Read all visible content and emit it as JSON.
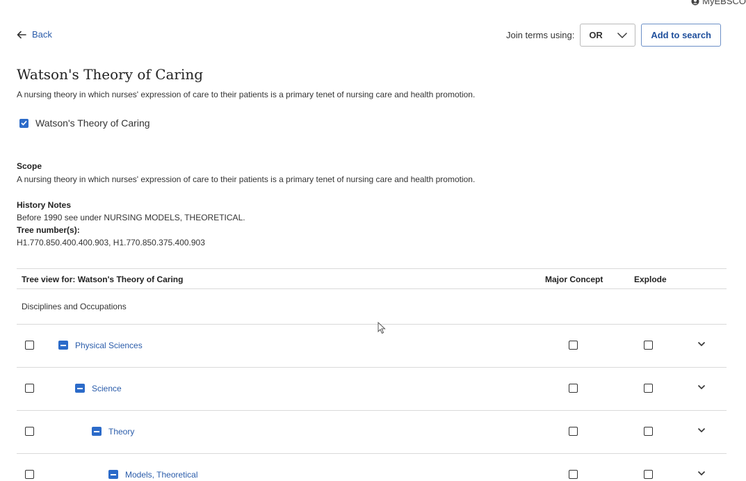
{
  "header": {
    "account_label": "MyEBSCO"
  },
  "nav": {
    "back_label": "Back"
  },
  "join": {
    "label": "Join terms using:",
    "selected": "OR",
    "add_button": "Add to search"
  },
  "term": {
    "title": "Watson's Theory of Caring",
    "description": "A nursing theory in which nurses' expression of care to their patients is a primary tenet of nursing care and health promotion.",
    "checkbox_label": "Watson's Theory of Caring",
    "checked": true
  },
  "details": {
    "scope_label": "Scope",
    "scope_text": "A nursing theory in which nurses' expression of care to their patients is a primary tenet of nursing care and health promotion.",
    "history_label": "History Notes",
    "history_text": "Before 1990 see under NURSING MODELS, THEORETICAL.",
    "tree_number_label": "Tree number(s):",
    "tree_number_text": "H1.770.850.400.400.903, H1.770.850.375.400.903"
  },
  "tree": {
    "header_title": "Tree view for: Watson's Theory of Caring",
    "col_major": "Major Concept",
    "col_explode": "Explode",
    "discipline": "Disciplines and Occupations",
    "rows": [
      {
        "label": "Physical Sciences",
        "level": 0
      },
      {
        "label": "Science",
        "level": 1
      },
      {
        "label": "Theory",
        "level": 2
      },
      {
        "label": "Models, Theoretical",
        "level": 3
      }
    ]
  },
  "colors": {
    "link": "#2a5caa",
    "accent": "#2c6bc9",
    "divider": "#d9d9d9"
  },
  "icons": [
    "user-icon",
    "arrow-left-icon",
    "chevron-down-icon",
    "checkbox-checked-icon",
    "collapse-minus-icon",
    "mouse-cursor-icon"
  ]
}
